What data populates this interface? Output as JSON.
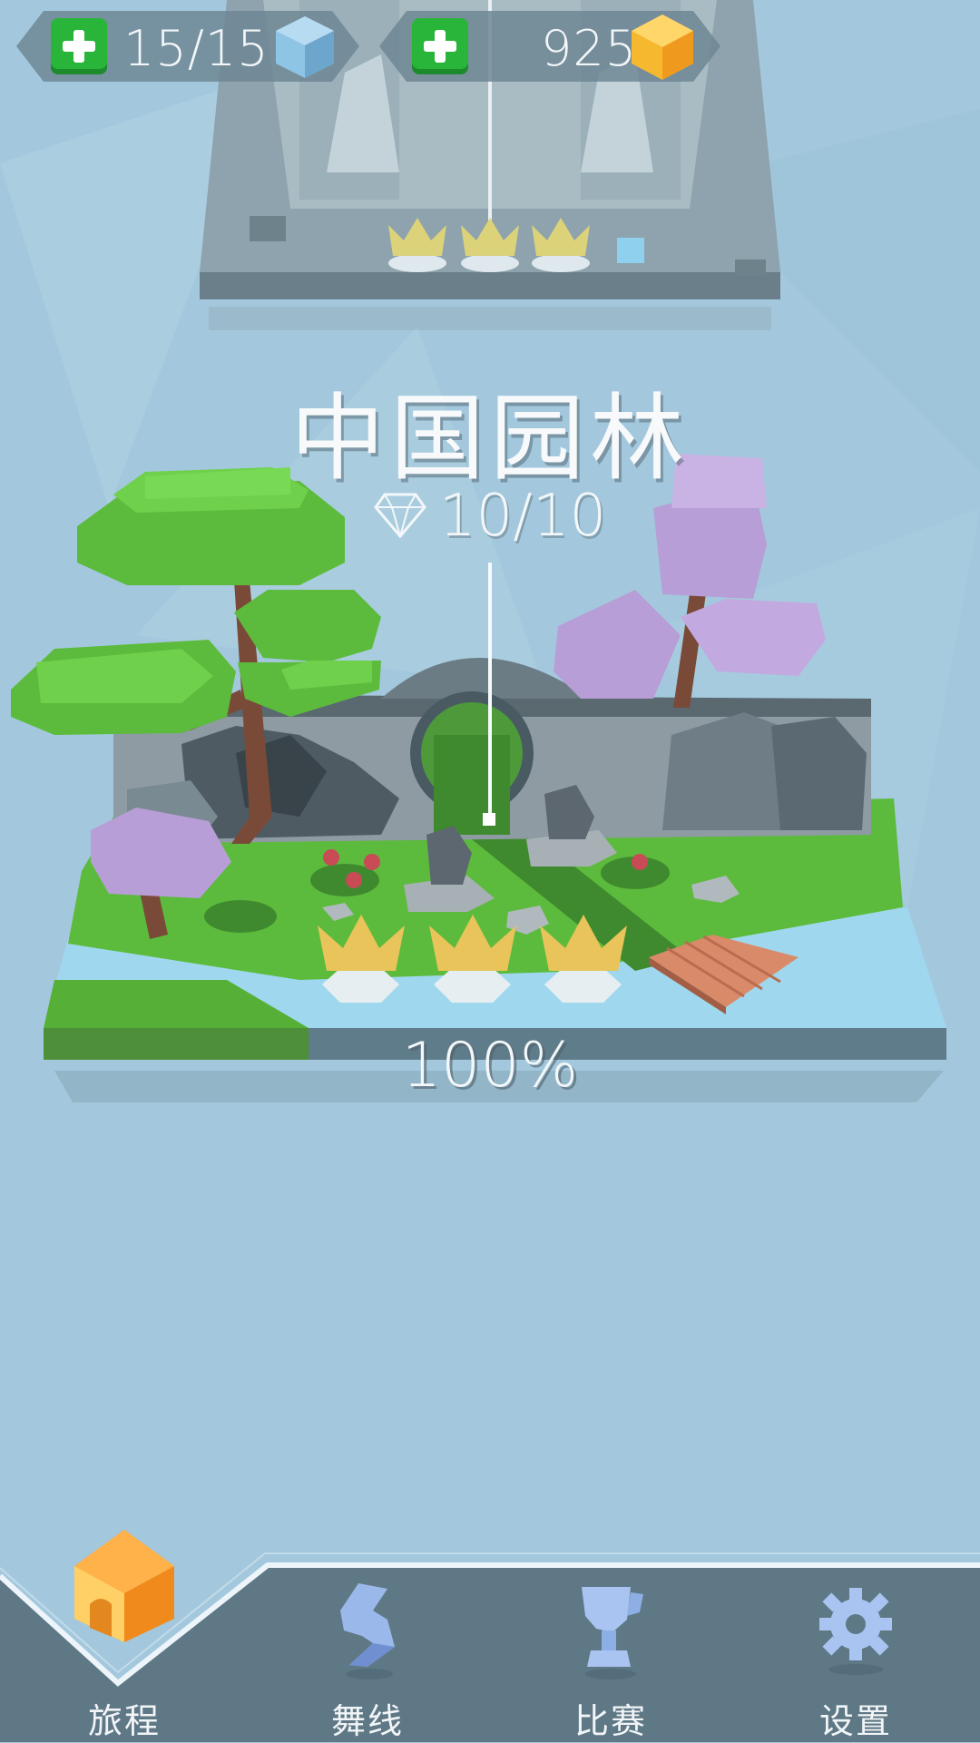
{
  "hud": {
    "energy": {
      "value": "15/15",
      "icon": "blue-cube-icon",
      "add_icon": "plus-icon"
    },
    "gems": {
      "value": "925",
      "icon": "gold-cube-icon",
      "add_icon": "plus-icon"
    }
  },
  "level": {
    "title": "中国园林",
    "diamonds": "10/10",
    "diamond_icon": "diamond-icon",
    "progress_text": "100%",
    "progress": 1.0,
    "crowns_earned": 3,
    "crowns_total": 3
  },
  "previous_level": {
    "crowns_earned": 3,
    "crowns_total": 3
  },
  "nav": {
    "items": [
      {
        "label": "旅程",
        "icon": "house-icon",
        "active": true
      },
      {
        "label": "舞线",
        "icon": "dance-line-icon",
        "active": false
      },
      {
        "label": "比赛",
        "icon": "trophy-icon",
        "active": false
      },
      {
        "label": "设置",
        "icon": "gear-icon",
        "active": false
      }
    ]
  },
  "colors": {
    "sky": "#a3c8dd",
    "nav_bar": "#5e7886",
    "accent_green": "#29b53a",
    "gold": "#f5b82e",
    "grass": "#5cbb3c",
    "blossom": "#b79ed6"
  }
}
